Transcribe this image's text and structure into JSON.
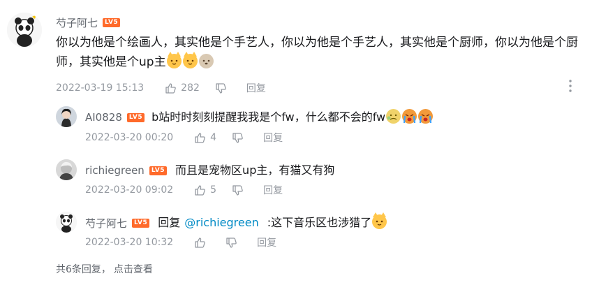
{
  "main_comment": {
    "username": "芍子阿七",
    "level": "LV5",
    "text": "你以为他是个绘画人，其实他是个手艺人，你以为他是个手艺人，其实他是个厨师，你以为他是个厨师，其实他是个up主",
    "emojis": [
      "cat-emoji",
      "cat-emoji",
      "dog-emoji"
    ],
    "time": "2022-03-19 15:13",
    "likes": "282",
    "reply_label": "回复"
  },
  "replies": [
    {
      "username": "AI0828",
      "level": "LV5",
      "text": "b站时时刻刻提醒我我是个fw，什么都不会的fw",
      "emojis": [
        "sick-face-emoji",
        "crying-emoji",
        "crying-emoji"
      ],
      "time": "2022-03-20 00:20",
      "likes": "4",
      "reply_label": "回复"
    },
    {
      "username": "richiegreen",
      "level": "LV5",
      "text": "而且是宠物区up主，有猫又有狗",
      "time": "2022-03-20 09:02",
      "likes": "5",
      "reply_label": "回复"
    },
    {
      "username": "芍子阿七",
      "level": "LV5",
      "reply_prefix": "回复",
      "mention": "@richiegreen",
      "text": ":这下音乐区也涉猎了",
      "emojis": [
        "cat-emoji"
      ],
      "time": "2022-03-20 10:32",
      "likes": "",
      "reply_label": "回复"
    }
  ],
  "footer": {
    "count_text": "共6条回复，",
    "view_link": "点击查看"
  },
  "colors": {
    "level_badge": "#ff6a2a",
    "meta_gray": "#9499a0",
    "mention_blue": "#008ac5"
  }
}
